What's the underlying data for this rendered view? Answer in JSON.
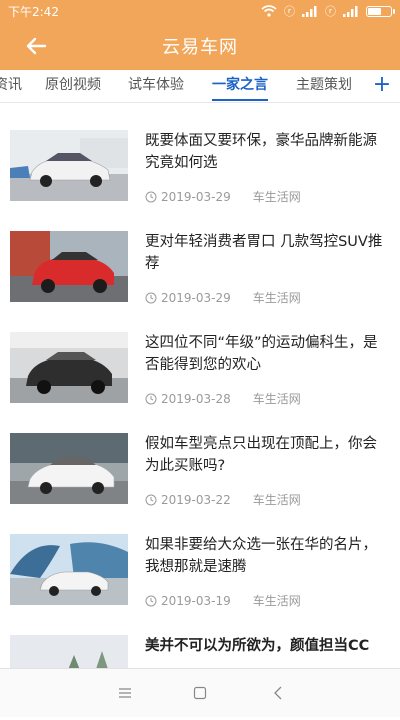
{
  "status": {
    "time": "下午2:42",
    "battery_percent": 65
  },
  "header": {
    "title": "云易车网"
  },
  "tabs": [
    {
      "label": "资讯",
      "active": false
    },
    {
      "label": "原创视频",
      "active": false
    },
    {
      "label": "试车体验",
      "active": false
    },
    {
      "label": "一家之言",
      "active": true
    },
    {
      "label": "主题策划",
      "active": false
    }
  ],
  "articles": [
    {
      "title": "既要体面又要环保，豪华品牌新能源究竟如何选",
      "date": "2019-03-29",
      "source": "车生活网",
      "car_color": "#f2f2f2"
    },
    {
      "title": "更对年轻消费者胃口 几款驾控SUV推荐",
      "date": "2019-03-29",
      "source": "车生活网",
      "car_color": "#d92b2b"
    },
    {
      "title": "这四位不同“年级”的运动偏科生，是否能得到您的欢心",
      "date": "2019-03-28",
      "source": "车生活网",
      "car_color": "#2e2e2e"
    },
    {
      "title": "假如车型亮点只出现在顶配上，你会为此买账吗?",
      "date": "2019-03-22",
      "source": "车生活网",
      "car_color": "#f4f4f4"
    },
    {
      "title": "如果非要给大众选一张在华的名片，我想那就是速腾",
      "date": "2019-03-19",
      "source": "车生活网",
      "car_color": "#f4f4f4"
    },
    {
      "title": "美并不可以为所欲为，颜值担当CC",
      "date": "",
      "source": "",
      "car_color": "#dddddd"
    }
  ],
  "colors": {
    "accent": "#f2a65a",
    "tab_active": "#1b63c6"
  }
}
